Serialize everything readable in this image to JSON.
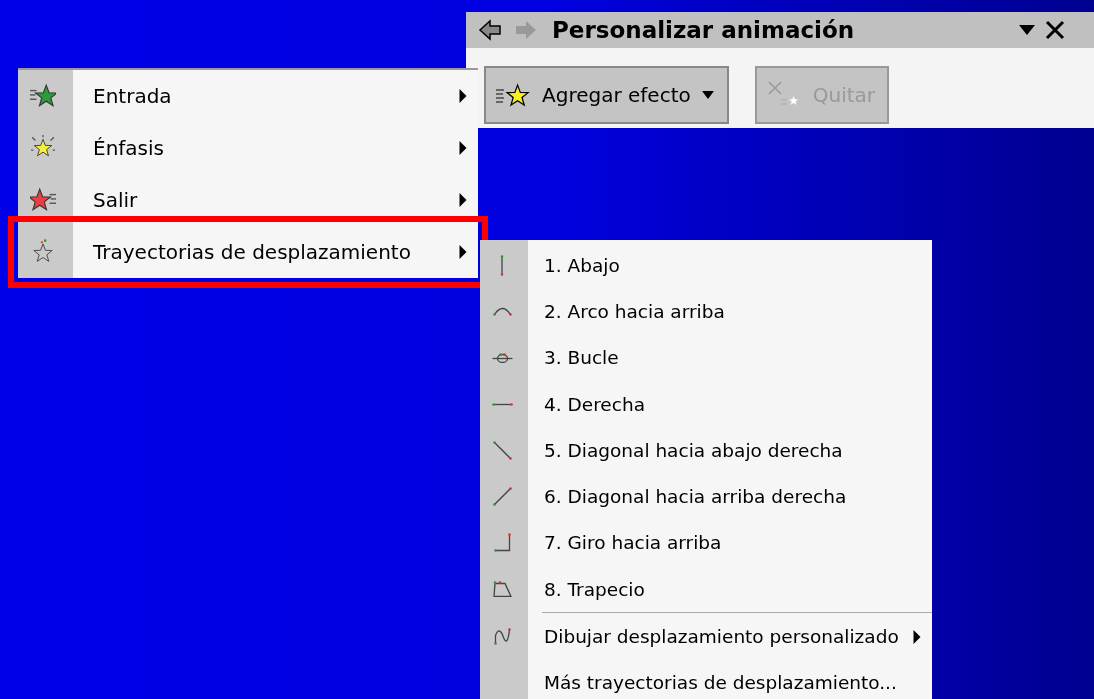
{
  "task_pane": {
    "title": "Personalizar animación",
    "add_button": {
      "label": "Agregar efecto",
      "disabled": false
    },
    "remove_button": {
      "label": "Quitar",
      "disabled": true
    }
  },
  "effect_menu": {
    "items": [
      {
        "label": "Entrada",
        "kind": "entrance",
        "has_submenu": true,
        "selected": false
      },
      {
        "label": "Énfasis",
        "kind": "emphasis",
        "has_submenu": true,
        "selected": false
      },
      {
        "label": "Salir",
        "kind": "exit",
        "has_submenu": true,
        "selected": false
      },
      {
        "label": "Trayectorias de desplazamiento",
        "kind": "motion",
        "has_submenu": true,
        "selected": true
      }
    ]
  },
  "motion_submenu": {
    "presets": [
      {
        "label": "1. Abajo",
        "kind": "down"
      },
      {
        "label": "2. Arco hacia arriba",
        "kind": "arc"
      },
      {
        "label": "3. Bucle",
        "kind": "loop"
      },
      {
        "label": "4. Derecha",
        "kind": "right"
      },
      {
        "label": "5. Diagonal hacia abajo derecha",
        "kind": "diag-down"
      },
      {
        "label": "6. Diagonal hacia arriba derecha",
        "kind": "diag-up"
      },
      {
        "label": "7. Giro hacia arriba",
        "kind": "turn-up"
      },
      {
        "label": "8. Trapecio",
        "kind": "trapezoid"
      }
    ],
    "extras": [
      {
        "label": "Dibujar desplazamiento personalizado",
        "kind": "freeform",
        "has_submenu": true
      },
      {
        "label": "Más trayectorias de desplazamiento...",
        "kind": "none",
        "has_submenu": false
      }
    ]
  }
}
